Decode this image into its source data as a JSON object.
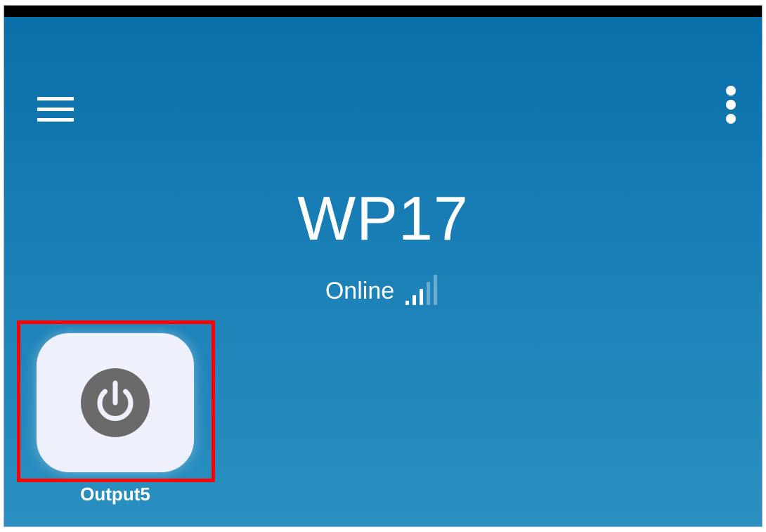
{
  "header": {
    "menu_icon": "hamburger-menu-icon",
    "more_icon": "more-vert-icon"
  },
  "device": {
    "name": "WP17",
    "status": "Online",
    "signal_icon": "signal-strength-icon",
    "signal_bars_active": 3,
    "signal_bars_total": 5
  },
  "outputs": [
    {
      "label": "Output5",
      "icon": "power-icon"
    }
  ],
  "colors": {
    "background_top": "#0a6fa9",
    "background_bottom": "#2a8fc0",
    "tile": "#eef1fb",
    "power_icon_fill": "#6a6a6a",
    "highlight": "#ff0000"
  }
}
